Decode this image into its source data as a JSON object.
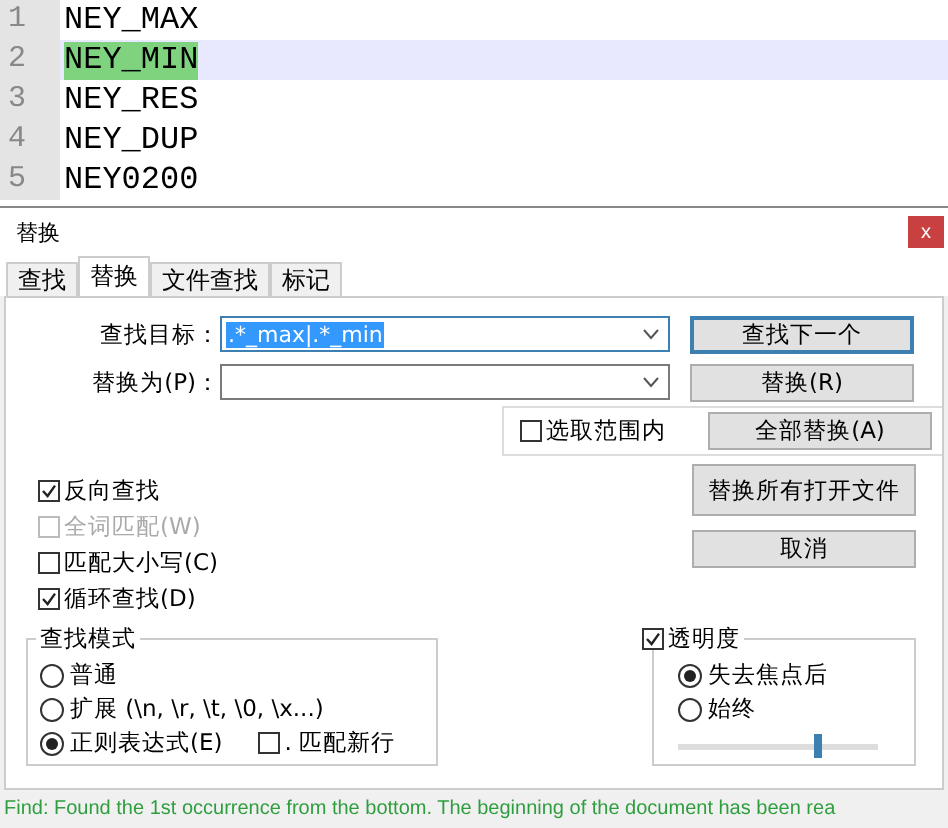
{
  "editor": {
    "lines": [
      {
        "number": "1",
        "text": "NEY_MAX",
        "selected": false
      },
      {
        "number": "2",
        "text": "NEY_MIN",
        "selected": true
      },
      {
        "number": "3",
        "text": "NEY_RES",
        "selected": false
      },
      {
        "number": "4",
        "text": "NEY_DUP",
        "selected": false
      },
      {
        "number": "5",
        "text": "NEY0200",
        "selected": false
      }
    ]
  },
  "dialog": {
    "title": "替换",
    "close": "x",
    "tabs": [
      {
        "label": "查找",
        "selected": false
      },
      {
        "label": "替换",
        "selected": true
      },
      {
        "label": "文件查找",
        "selected": false
      },
      {
        "label": "标记",
        "selected": false
      }
    ],
    "find": {
      "label": "查找目标：",
      "value": ".*_max|.*_min"
    },
    "replace": {
      "label": "替换为(P)："
    },
    "in_selection": {
      "label": "选取范围内",
      "checked": false
    },
    "buttons": [
      {
        "label": "查找下一个",
        "default": true
      },
      {
        "label": "替换(R)",
        "default": false
      },
      {
        "label": "全部替换(A)",
        "default": false
      },
      {
        "label": "替换所有打开文件",
        "default": false
      },
      {
        "label": "取消",
        "default": false
      }
    ],
    "options": [
      {
        "label": "反向查找",
        "checked": true,
        "disabled": false
      },
      {
        "label": "全词匹配(W)",
        "checked": false,
        "disabled": true
      },
      {
        "label": "匹配大小写(C)",
        "checked": false,
        "disabled": false
      },
      {
        "label": "循环查找(D)",
        "checked": true,
        "disabled": false
      }
    ],
    "search_mode": {
      "title": "查找模式",
      "options": [
        {
          "label": "普通",
          "selected": false
        },
        {
          "label": "扩展 (\\n, \\r, \\t, \\0, \\x...)",
          "selected": false
        },
        {
          "label": "正则表达式(E)",
          "selected": true
        }
      ],
      "dot_newline": {
        "label": ". 匹配新行",
        "checked": false
      }
    },
    "transparency": {
      "label": "透明度",
      "checked": true,
      "options": [
        {
          "label": "失去焦点后",
          "selected": true
        },
        {
          "label": "始终",
          "selected": false
        }
      ],
      "level": 0.7
    }
  },
  "status": "Find: Found the 1st occurrence from the bottom. The beginning of the document has been rea"
}
